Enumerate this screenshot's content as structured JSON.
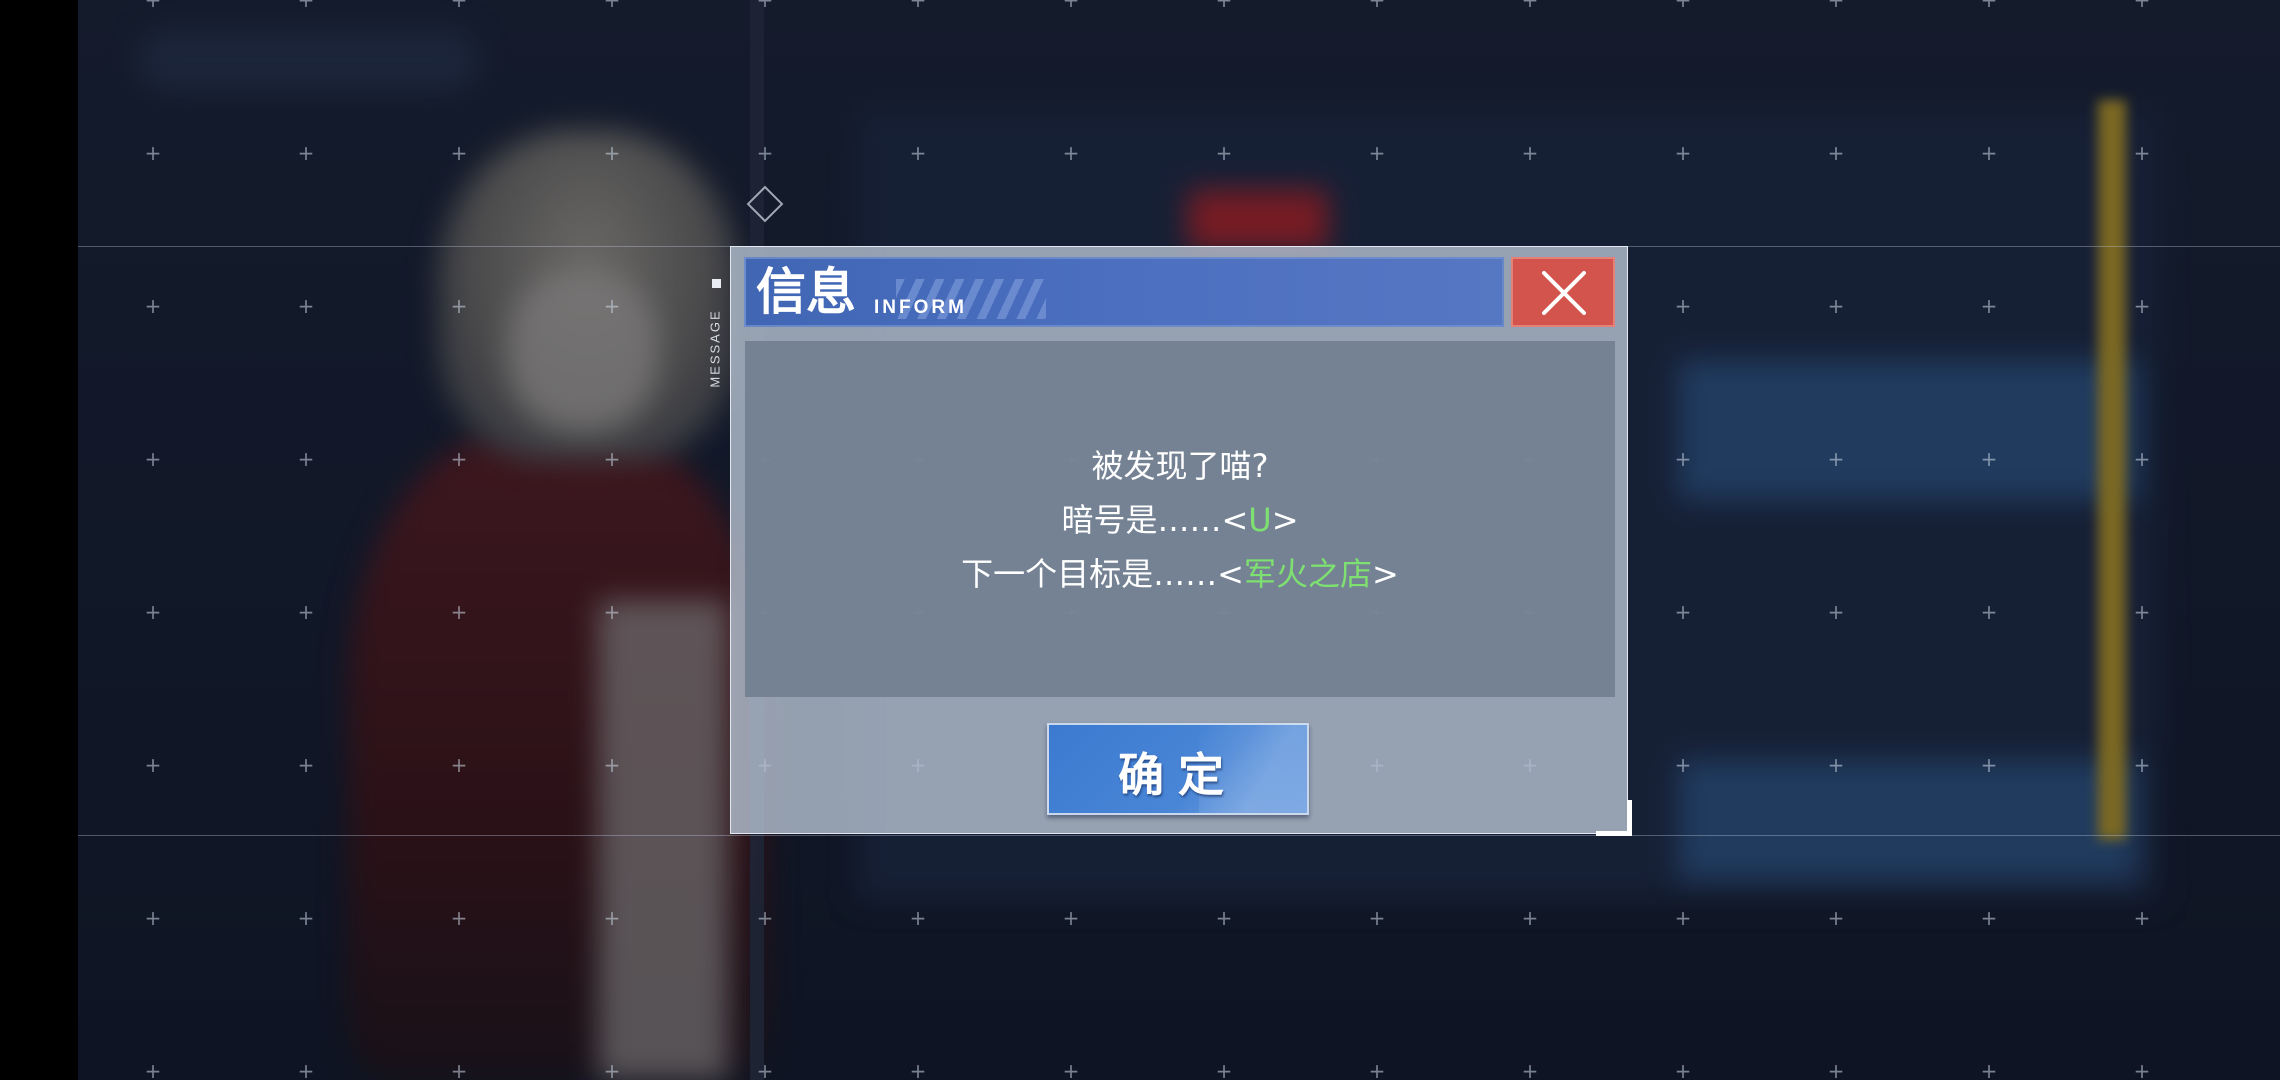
{
  "dialog": {
    "title": "信息",
    "subtitle": "INFORM",
    "side_label": "MESSAGE",
    "close_icon": "close-icon",
    "message": {
      "line1": "被发现了喵?",
      "line2_prefix": "暗号是……<",
      "line2_code": "U",
      "line2_suffix": ">",
      "line3_prefix": "下一个目标是……<",
      "line3_target": "军火之店",
      "line3_suffix": ">"
    },
    "confirm_label": "确定"
  },
  "colors": {
    "header_blue": "#4c6fc0",
    "close_red": "#d2544d",
    "highlight_green": "#7ee070",
    "confirm_blue": "#4a86d6"
  }
}
